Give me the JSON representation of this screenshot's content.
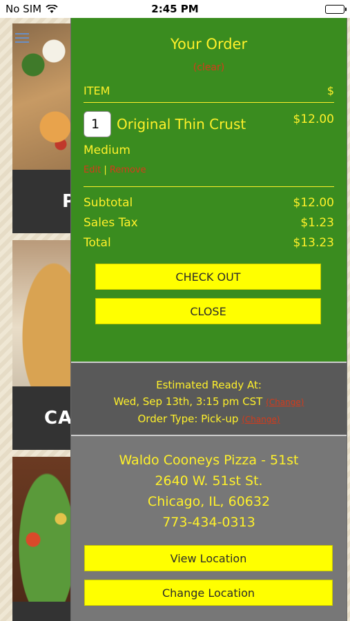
{
  "status_bar": {
    "carrier": "No SIM",
    "time": "2:45 PM"
  },
  "background_menu": {
    "tiles": [
      {
        "label": "P"
      },
      {
        "label": "CAL"
      },
      {
        "label": ""
      }
    ]
  },
  "order": {
    "title": "Your Order",
    "clear_label": "(clear)",
    "header_item": "ITEM",
    "header_price": "$",
    "items": [
      {
        "qty": "1",
        "name": "Original Thin Crust",
        "price": "$12.00",
        "size": "Medium",
        "edit_label": "Edit",
        "separator": "|",
        "remove_label": "Remove"
      }
    ],
    "subtotal_label": "Subtotal",
    "subtotal_value": "$12.00",
    "tax_label": "Sales Tax",
    "tax_value": "$1.23",
    "total_label": "Total",
    "total_value": "$13.23",
    "checkout_label": "CHECK OUT",
    "close_label": "CLOSE"
  },
  "ready": {
    "estimated_label": "Estimated Ready At:",
    "estimated_time": "Wed, Sep 13th, 3:15 pm CST",
    "change_label": "(Change)",
    "order_type": "Order Type: Pick-up",
    "order_type_change": "(Change)"
  },
  "store": {
    "name": "Waldo Cooneys Pizza - 51st",
    "address": "2640 W. 51st St.",
    "city": "Chicago, IL, 60632",
    "phone": "773-434-0313",
    "view_location_label": "View Location",
    "change_location_label": "Change Location"
  },
  "colors": {
    "panel_green": "#3a8c1f",
    "text_yellow": "#fff12a",
    "button_yellow": "#ffff00",
    "link_red": "#d63a1a",
    "ready_gray": "#595959",
    "store_gray": "#777777"
  }
}
